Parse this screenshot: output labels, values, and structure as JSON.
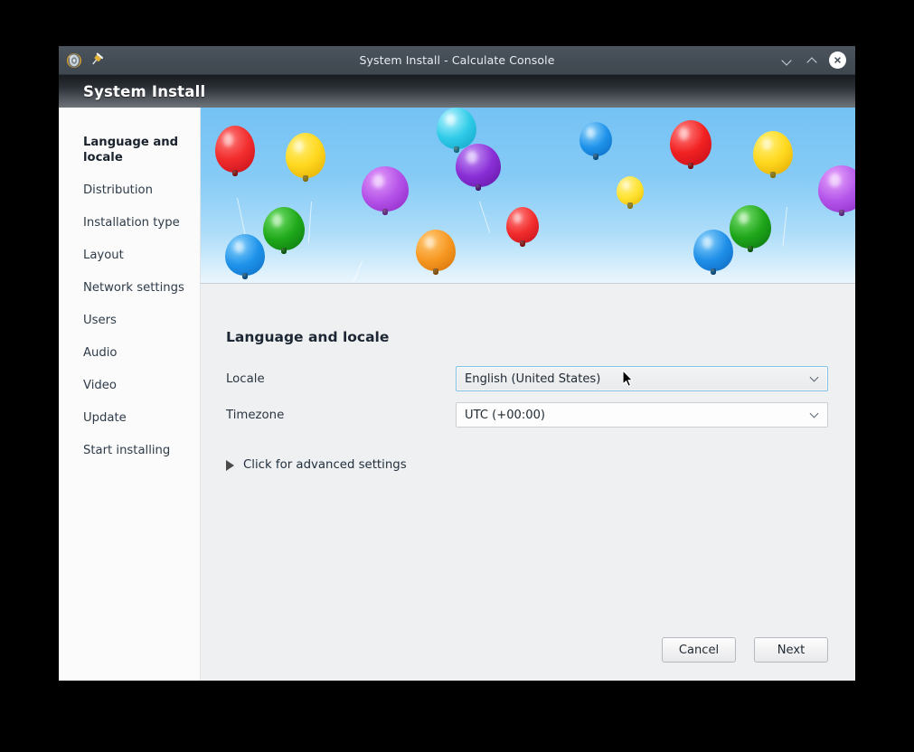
{
  "titlebar": {
    "title": "System Install - Calculate Console",
    "app_icon": "disc-icon",
    "pin_icon": "pin-icon",
    "minimize_icon": "chevron-down-icon",
    "maximize_icon": "chevron-up-icon",
    "close_icon": "close-icon"
  },
  "header": {
    "title": "System Install"
  },
  "sidebar": {
    "items": [
      {
        "label": "Language and locale",
        "active": true
      },
      {
        "label": "Distribution",
        "active": false
      },
      {
        "label": "Installation type",
        "active": false
      },
      {
        "label": "Layout",
        "active": false
      },
      {
        "label": "Network settings",
        "active": false
      },
      {
        "label": "Users",
        "active": false
      },
      {
        "label": "Audio",
        "active": false
      },
      {
        "label": "Video",
        "active": false
      },
      {
        "label": "Update",
        "active": false
      },
      {
        "label": "Start installing",
        "active": false
      }
    ]
  },
  "banner": {
    "alt": "balloons-banner",
    "sky_top_color": "#74c2f4",
    "sky_bottom_color": "#eaf6fd"
  },
  "main": {
    "section_title": "Language and locale",
    "fields": [
      {
        "label": "Locale",
        "value": "English (United States)",
        "state": "hover"
      },
      {
        "label": "Timezone",
        "value": "UTC (+00:00)",
        "state": "normal"
      }
    ],
    "advanced": {
      "label": "Click for advanced settings",
      "icon": "triangle-right-icon",
      "expanded": false
    }
  },
  "footer": {
    "cancel_label": "Cancel",
    "next_label": "Next"
  },
  "colors": {
    "titlebar": "#444c55",
    "header_gradient_top": "#181c20",
    "header_gradient_bottom": "#6e737a",
    "sidebar_bg": "#fbfbfb",
    "content_bg": "#eff0f2",
    "focus_border": "#86c2e4",
    "text": "#1f2933"
  }
}
